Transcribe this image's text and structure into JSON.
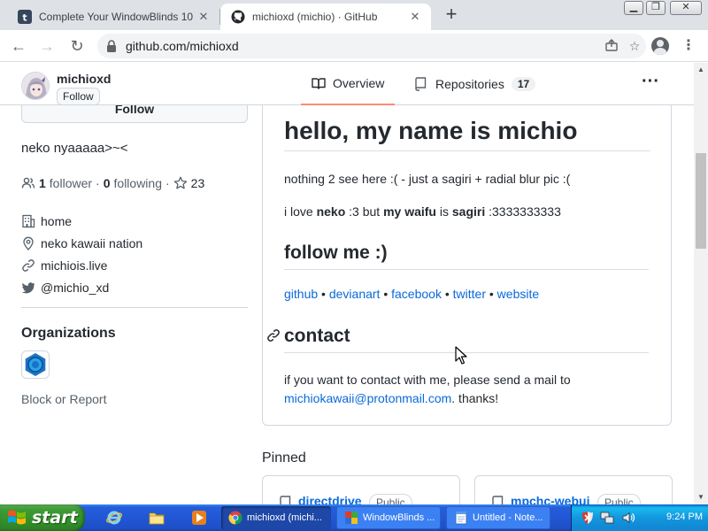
{
  "browser": {
    "tabs": [
      {
        "title": "Complete Your WindowBlinds 10",
        "favicon": "tumblr-t-icon"
      },
      {
        "title": "michioxd (michio) · GitHub",
        "favicon": "github-icon"
      }
    ],
    "url": "github.com/michioxd"
  },
  "profile": {
    "username": "michioxd",
    "follow_label": "Follow",
    "bio": "neko nyaaaaa>~<",
    "followers_count": "1",
    "followers_label": "follower",
    "following_count": "0",
    "following_label": "following",
    "stars_count": "23",
    "details": [
      {
        "icon": "building-icon",
        "text": "home"
      },
      {
        "icon": "location-icon",
        "text": "neko kawaii nation"
      },
      {
        "icon": "link-icon",
        "text": "michiois.live"
      },
      {
        "icon": "twitter-icon",
        "text": "@michio_xd"
      }
    ],
    "organizations_title": "Organizations",
    "block_report": "Block or Report"
  },
  "nav": {
    "overview_label": "Overview",
    "repositories_label": "Repositories",
    "repositories_count": "17"
  },
  "readme": {
    "heading": "hello, my name is michio",
    "para1": "nothing 2 see here :( - just a sagiri + radial blur pic :(",
    "para2": {
      "t1": "i love ",
      "b1": "neko",
      "t2": " :3 but ",
      "b2": "my waifu",
      "t3": " is ",
      "b3": "sagiri",
      "t4": " :3333333333"
    },
    "follow_heading": "follow me :)",
    "links": [
      "github",
      "devianart",
      "facebook",
      "twitter",
      "website"
    ],
    "link_sep": " • ",
    "contact_heading": "contact",
    "contact_text": "if you want to contact with me, please send a mail to ",
    "contact_email": "michiokawaii@protonmail.com",
    "contact_tail": ". thanks!"
  },
  "pinned": {
    "title": "Pinned",
    "repos": [
      {
        "name": "directdrive",
        "badge": "Public"
      },
      {
        "name": "mpchc-webui",
        "badge": "Public"
      }
    ]
  },
  "taskbar": {
    "start_label": "start",
    "tasks": [
      {
        "title": "michioxd (michi...",
        "icon": "chrome-icon"
      },
      {
        "title": "WindowBlinds ...",
        "icon": "windowblinds-icon"
      },
      {
        "title": "Untitled - Note...",
        "icon": "notepad-icon"
      }
    ],
    "clock": "9:24 PM"
  },
  "colors": {
    "link": "#0969da",
    "tab_underline": "#fd8c73",
    "taskbar_blue": "#245edb",
    "start_green": "#3c9b34"
  }
}
